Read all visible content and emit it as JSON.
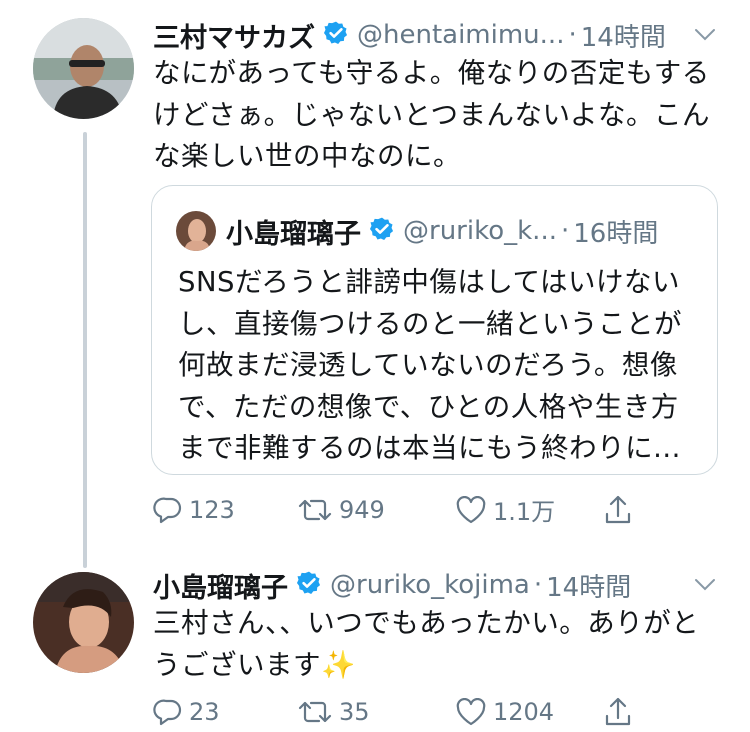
{
  "tweet1": {
    "name": "三村マサカズ",
    "handle": "@hentaimimu...",
    "dot": "·",
    "time": "14時間",
    "text": "なにがあっても守るよ。俺なりの否定もするけどさぁ。じゃないとつまんないよな。こんな楽しい世の中なのに。",
    "quote": {
      "name": "小島瑠璃子",
      "handle": "@ruriko_k...",
      "dot": "·",
      "time": "16時間",
      "text": "SNSだろうと誹謗中傷はしてはいけないし、直接傷つけるのと一緒ということが何故まだ浸透していないのだろう。想像で、ただの想像で、ひとの人格や生き方まで非難するのは本当にもう終わりに..."
    },
    "actions": {
      "replies": "123",
      "retweets": "949",
      "likes": "1.1万"
    }
  },
  "tweet2": {
    "name": "小島瑠璃子",
    "handle": "@ruriko_kojima",
    "dot": "·",
    "time": "14時間",
    "text": "三村さん、、いつでもあったかい。ありがとうございます✨",
    "actions": {
      "replies": "23",
      "retweets": "35",
      "likes": "1204"
    }
  },
  "colors": {
    "verified": "#1da1f2",
    "secondary": "#657786",
    "border": "#cfd9de",
    "thread_line": "#c9d1d8"
  }
}
